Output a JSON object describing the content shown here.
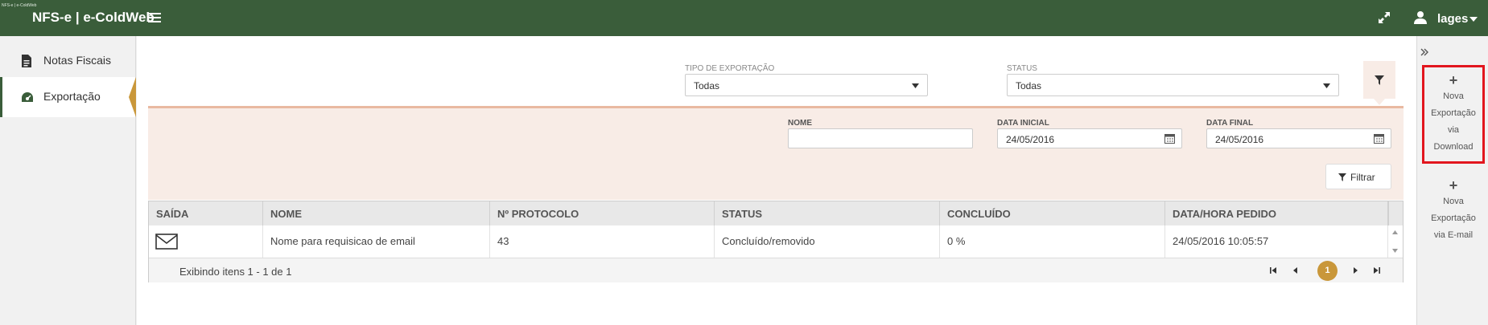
{
  "header": {
    "brand_mini": "NFS-e | e-ColdWeb",
    "brand": "NFS-e | e-ColdWeb",
    "user": "lages"
  },
  "sidebar": {
    "items": [
      {
        "label": "Notas Fiscais",
        "icon": "document-icon"
      },
      {
        "label": "Exportação",
        "icon": "dashboard-icon",
        "active": true
      }
    ]
  },
  "filters": {
    "tipo_label": "TIPO DE EXPORTAÇÃO",
    "tipo_value": "Todas",
    "status_label": "STATUS",
    "status_value": "Todas",
    "nome_label": "NOME",
    "nome_value": "",
    "data_inicial_label": "DATA INICIAL",
    "data_inicial_value": "24/05/2016",
    "data_final_label": "DATA FINAL",
    "data_final_value": "24/05/2016",
    "filtrar_label": "Filtrar"
  },
  "grid": {
    "columns": [
      "SAÍDA",
      "NOME",
      "Nº PROTOCOLO",
      "STATUS",
      "CONCLUÍDO",
      "DATA/HORA PEDIDO"
    ],
    "rows": [
      {
        "saida": "email-icon",
        "nome": "Nome para requisicao de email",
        "protocolo": "43",
        "status": "Concluído/removido",
        "concluido": "0 %",
        "data_hora": "24/05/2016 10:05:57"
      }
    ],
    "footer": "Exibindo itens 1 - 1 de 1",
    "current_page": "1"
  },
  "actions": {
    "download_lines": [
      "Nova",
      "Exportação",
      "via",
      "Download"
    ],
    "email_lines": [
      "Nova",
      "Exportação",
      "via E-mail"
    ],
    "highlight_color": "#e2161e"
  },
  "colors": {
    "topbar": "#3a5d3a",
    "accent": "#c9973a",
    "filter_panel": "#f8ece6"
  }
}
